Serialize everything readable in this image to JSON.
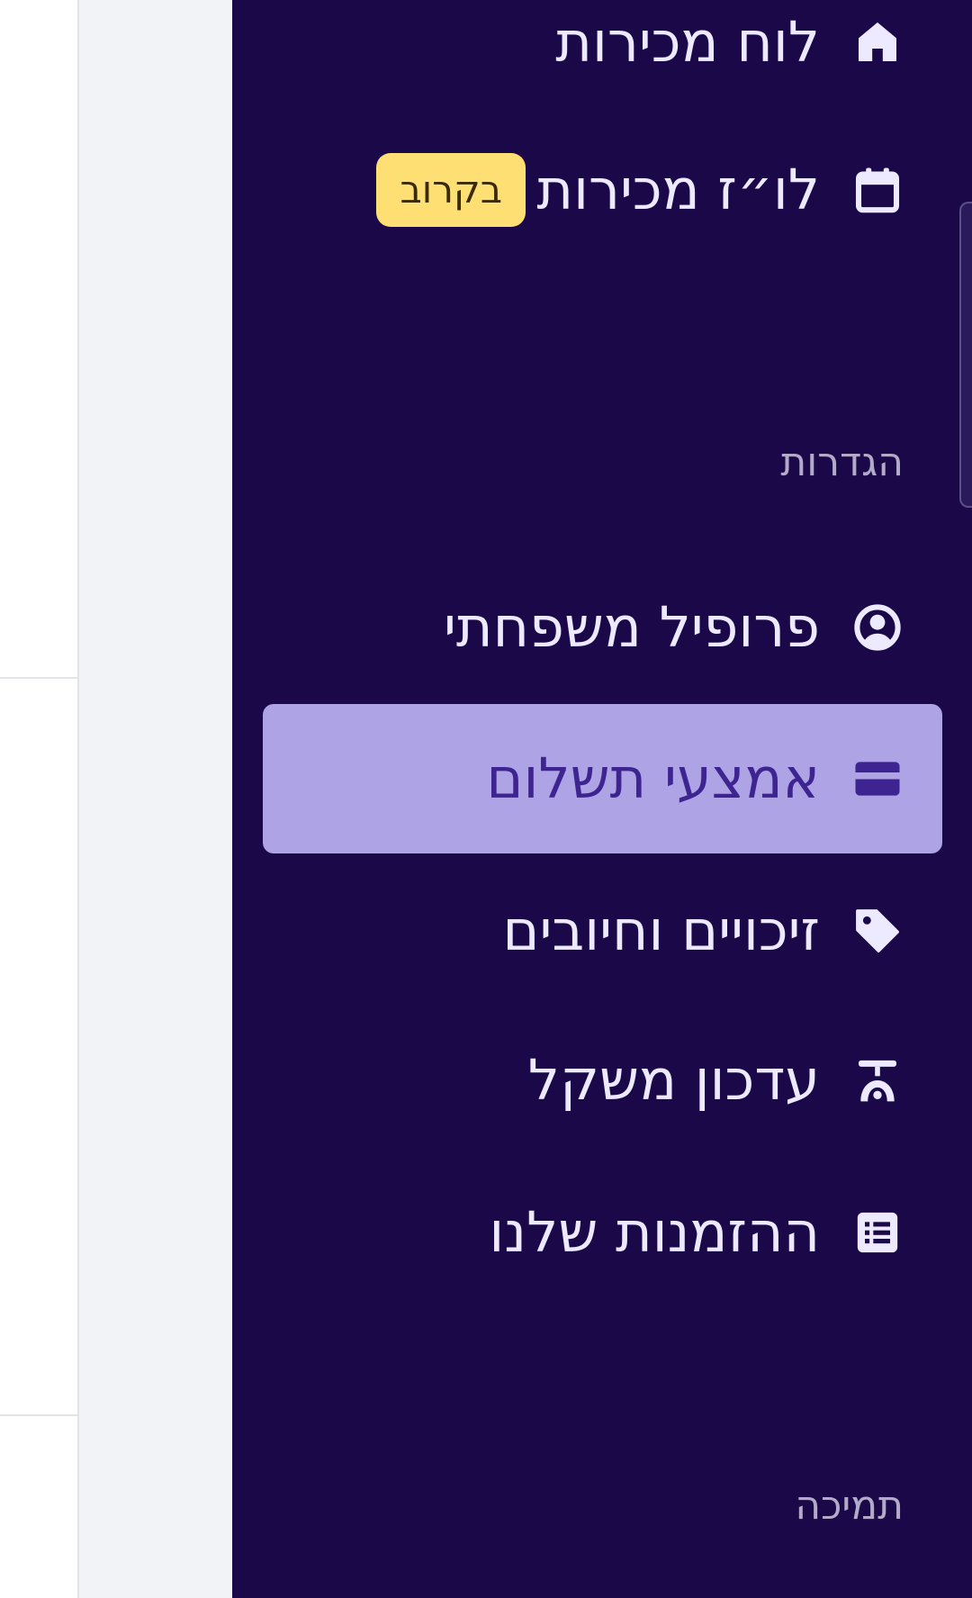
{
  "sidebar": {
    "items": [
      {
        "label": "לוח מכירות",
        "icon": "home-icon"
      },
      {
        "label": "לו״ז מכירות",
        "icon": "calendar-icon",
        "badge": "בקרוב"
      }
    ],
    "settings": {
      "title": "הגדרות",
      "items": [
        {
          "label": "פרופיל משפחתי",
          "icon": "user-circle-icon"
        },
        {
          "label": "אמצעי תשלום",
          "icon": "credit-card-icon",
          "active": true
        },
        {
          "label": "זיכויים וחיובים",
          "icon": "tag-icon"
        },
        {
          "label": "עדכון משקל",
          "icon": "scale-icon"
        },
        {
          "label": "ההזמנות שלנו",
          "icon": "list-icon"
        }
      ]
    },
    "support": {
      "title": "תמיכה"
    }
  },
  "colors": {
    "sidebar_bg": "#1b0849",
    "active_bg": "#aea4e5",
    "active_text": "#3d2490",
    "badge_bg": "#fddf73"
  }
}
